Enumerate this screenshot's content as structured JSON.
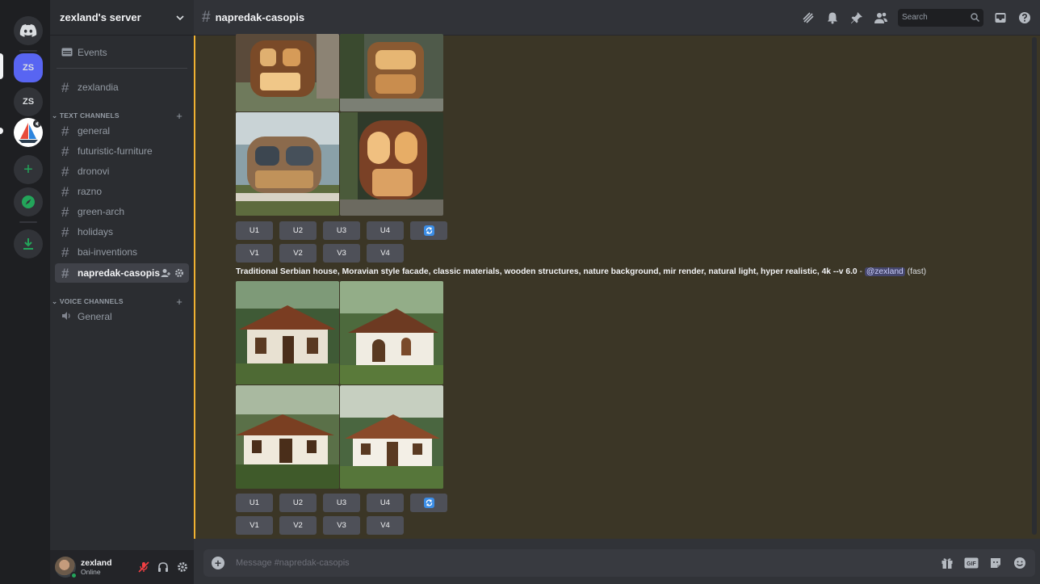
{
  "rail": {
    "servers": [
      {
        "label": "ZS"
      },
      {
        "label": "ZS"
      }
    ]
  },
  "sidebar": {
    "server_name": "zexland's server",
    "events_label": "Events",
    "top_channel": "zexlandia",
    "text_category": "TEXT CHANNELS",
    "text_channels": [
      "general",
      "futuristic-furniture",
      "dronovi",
      "razno",
      "green-arch",
      "holidays",
      "bai-inventions",
      "napredak-casopis"
    ],
    "voice_category": "VOICE CHANNELS",
    "voice_channels": [
      "General"
    ]
  },
  "user": {
    "name": "zexland",
    "status": "Online"
  },
  "header": {
    "channel": "napredak-casopis",
    "search_placeholder": "Search"
  },
  "messages": [
    {
      "upscale": [
        "U1",
        "U2",
        "U3",
        "U4"
      ],
      "variation": [
        "V1",
        "V2",
        "V3",
        "V4"
      ]
    },
    {
      "prompt": "Traditional Serbian house, Moravian style facade, classic materials, wooden structures, nature background, mir render, natural light, hyper realistic, 4k --v 6.0",
      "separator": " - ",
      "mention": "@zexland",
      "speed": "(fast)",
      "upscale": [
        "U1",
        "U2",
        "U3",
        "U4"
      ],
      "variation": [
        "V1",
        "V2",
        "V3",
        "V4"
      ]
    }
  ],
  "composer": {
    "placeholder": "Message #napredak-casopis"
  },
  "colors": {
    "accent": "#5865f2",
    "online": "#23a55a",
    "highlight_bar": "#f0b232",
    "chat_bg": "#3b3626"
  }
}
